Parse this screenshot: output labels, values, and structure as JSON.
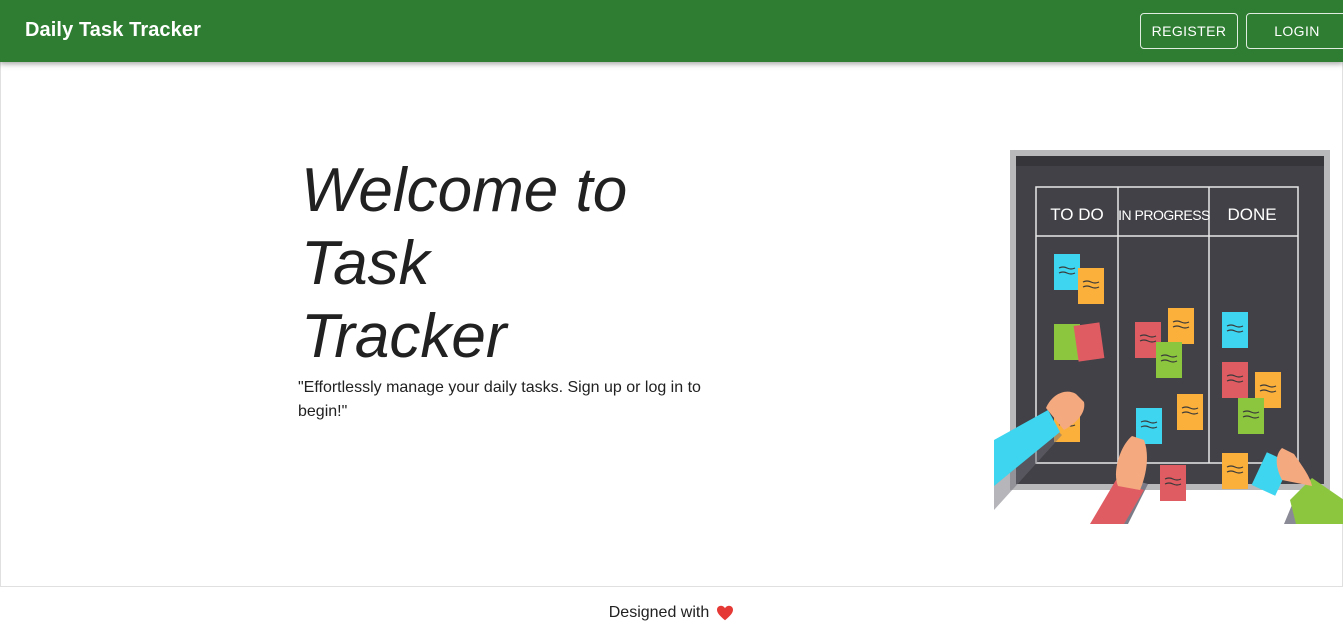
{
  "header": {
    "title": "Daily Task Tracker",
    "register_label": "REGISTER",
    "login_label": "LOGIN"
  },
  "hero": {
    "title_line1": "Welcome to",
    "title_line2": "Task",
    "title_line3": "Tracker",
    "tagline": "\"Effortlessly manage your daily tasks. Sign up or log in to begin!\""
  },
  "board": {
    "columns": [
      "TO DO",
      "IN PROGRESS",
      "DONE"
    ]
  },
  "footer": {
    "text": "Designed with",
    "icon": "heart-icon"
  },
  "colors": {
    "appbar": "#2e7d32",
    "board": "#424147",
    "board_frame": "#b9b9bb",
    "note_cyan": "#3dd5ef",
    "note_orange": "#fbb03b",
    "note_red": "#e05c63",
    "note_green": "#8cc63f",
    "heart": "#e53935"
  }
}
